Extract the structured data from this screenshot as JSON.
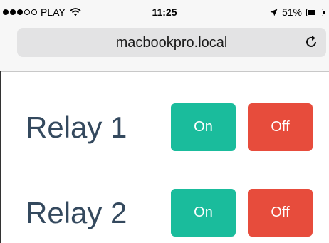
{
  "status_bar": {
    "carrier": "PLAY",
    "signal_bars_filled": 3,
    "signal_bars_total": 5,
    "time": "11:25",
    "battery": "51%",
    "battery_level": 0.51
  },
  "browser": {
    "url": "macbookpro.local"
  },
  "relays": [
    {
      "label": "Relay 1",
      "on_label": "On",
      "off_label": "Off"
    },
    {
      "label": "Relay 2",
      "on_label": "On",
      "off_label": "Off"
    }
  ],
  "colors": {
    "on": "#1abc9c",
    "off": "#e74c3c",
    "label": "#34495e"
  }
}
